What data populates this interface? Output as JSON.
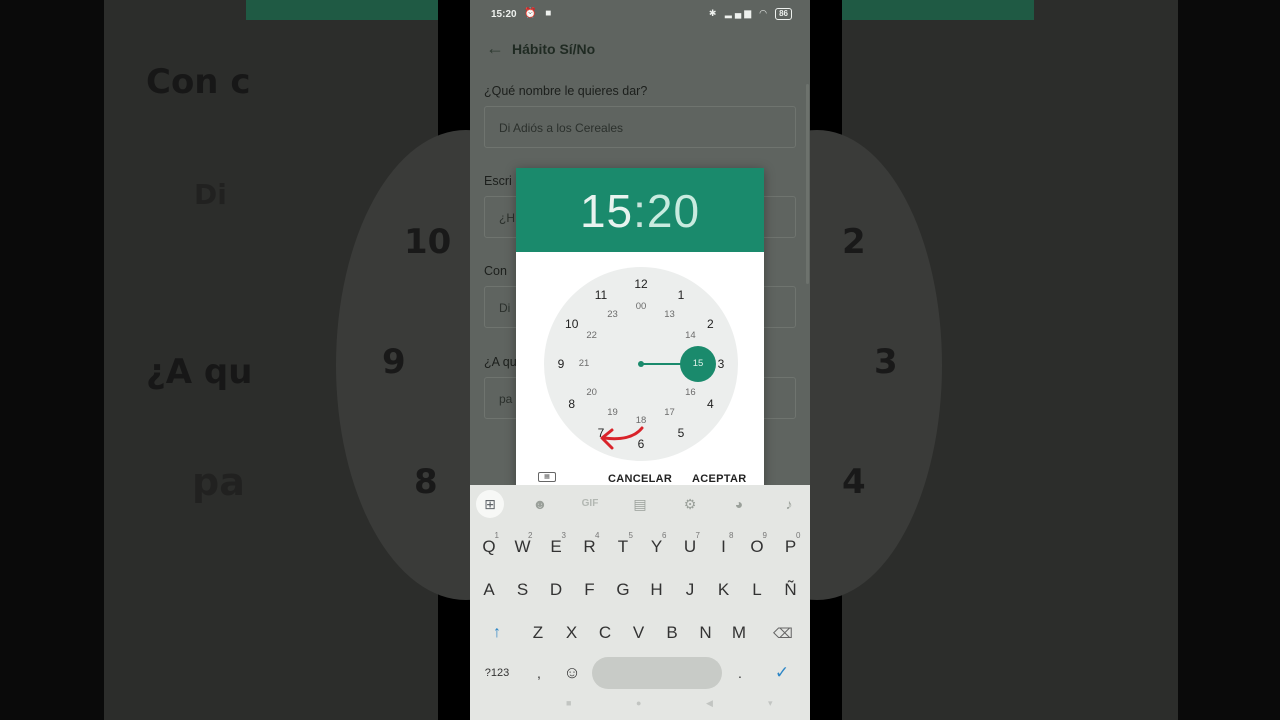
{
  "status_bar": {
    "time": "15:20",
    "left_icons": "⏰ ■",
    "right_icons": "✱ ▂▄▆ ◠",
    "battery": "86"
  },
  "app_bar": {
    "back_icon": "arrow-left-icon",
    "title": "Hábito Sí/No"
  },
  "form": {
    "name_label": "¿Qué nombre le quieres dar?",
    "name_value": "Di Adiós a los Cereales",
    "desc_label_visible": "Escri",
    "desc_value_visible": "¿H",
    "freq_label_visible": "Con",
    "freq_value_visible": "Di",
    "time_label_visible": "¿A qu",
    "time_value_visible": "pa"
  },
  "time_picker": {
    "hour": "15",
    "separator": ":",
    "minute": "20",
    "outer_numbers": [
      "12",
      "1",
      "2",
      "3",
      "4",
      "5",
      "6",
      "7",
      "8",
      "9",
      "10",
      "11"
    ],
    "inner_numbers": [
      "00",
      "13",
      "14",
      "15",
      "16",
      "17",
      "18",
      "19",
      "20",
      "21",
      "22",
      "23"
    ],
    "selected_hour": "15",
    "cancel_label": "CANCELAR",
    "accept_label": "ACEPTAR",
    "keyboard_toggle_icon": "keyboard-icon"
  },
  "keyboard": {
    "toolbar": [
      "apps-icon",
      "sticker-icon",
      "GIF",
      "clipboard-icon",
      "gear-icon",
      "palette-icon",
      "mic-icon"
    ],
    "row1": [
      "Q",
      "W",
      "E",
      "R",
      "T",
      "Y",
      "U",
      "I",
      "O",
      "P"
    ],
    "row1_hints": [
      "1",
      "2",
      "3",
      "4",
      "5",
      "6",
      "7",
      "8",
      "9",
      "0"
    ],
    "row2": [
      "A",
      "S",
      "D",
      "F",
      "G",
      "H",
      "J",
      "K",
      "L",
      "Ñ"
    ],
    "row3": [
      "Z",
      "X",
      "C",
      "V",
      "B",
      "N",
      "M"
    ],
    "shift_symbol": "↑",
    "delete_symbol": "⌫",
    "symbols_label": "?123",
    "comma": ",",
    "emoji_symbol": "☺",
    "period": ".",
    "enter_symbol": "✓"
  },
  "background": {
    "left_texts": [
      "Con c",
      "Di",
      "10",
      "9",
      "8",
      "¿A qu",
      "pa"
    ],
    "right_texts": [
      "2",
      "3",
      "4"
    ]
  },
  "colors": {
    "accent": "#1a8a6c",
    "annotation_arrow": "#d9232a"
  }
}
